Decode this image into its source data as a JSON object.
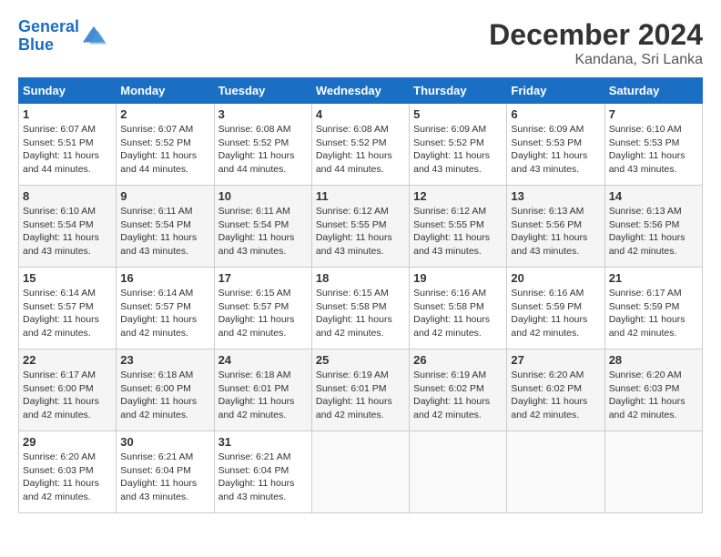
{
  "header": {
    "logo_line1": "General",
    "logo_line2": "Blue",
    "month_title": "December 2024",
    "location": "Kandana, Sri Lanka"
  },
  "weekdays": [
    "Sunday",
    "Monday",
    "Tuesday",
    "Wednesday",
    "Thursday",
    "Friday",
    "Saturday"
  ],
  "weeks": [
    [
      {
        "day": "1",
        "sunrise": "6:07 AM",
        "sunset": "5:51 PM",
        "daylight": "11 hours and 44 minutes."
      },
      {
        "day": "2",
        "sunrise": "6:07 AM",
        "sunset": "5:52 PM",
        "daylight": "11 hours and 44 minutes."
      },
      {
        "day": "3",
        "sunrise": "6:08 AM",
        "sunset": "5:52 PM",
        "daylight": "11 hours and 44 minutes."
      },
      {
        "day": "4",
        "sunrise": "6:08 AM",
        "sunset": "5:52 PM",
        "daylight": "11 hours and 44 minutes."
      },
      {
        "day": "5",
        "sunrise": "6:09 AM",
        "sunset": "5:52 PM",
        "daylight": "11 hours and 43 minutes."
      },
      {
        "day": "6",
        "sunrise": "6:09 AM",
        "sunset": "5:53 PM",
        "daylight": "11 hours and 43 minutes."
      },
      {
        "day": "7",
        "sunrise": "6:10 AM",
        "sunset": "5:53 PM",
        "daylight": "11 hours and 43 minutes."
      }
    ],
    [
      {
        "day": "8",
        "sunrise": "6:10 AM",
        "sunset": "5:54 PM",
        "daylight": "11 hours and 43 minutes."
      },
      {
        "day": "9",
        "sunrise": "6:11 AM",
        "sunset": "5:54 PM",
        "daylight": "11 hours and 43 minutes."
      },
      {
        "day": "10",
        "sunrise": "6:11 AM",
        "sunset": "5:54 PM",
        "daylight": "11 hours and 43 minutes."
      },
      {
        "day": "11",
        "sunrise": "6:12 AM",
        "sunset": "5:55 PM",
        "daylight": "11 hours and 43 minutes."
      },
      {
        "day": "12",
        "sunrise": "6:12 AM",
        "sunset": "5:55 PM",
        "daylight": "11 hours and 43 minutes."
      },
      {
        "day": "13",
        "sunrise": "6:13 AM",
        "sunset": "5:56 PM",
        "daylight": "11 hours and 43 minutes."
      },
      {
        "day": "14",
        "sunrise": "6:13 AM",
        "sunset": "5:56 PM",
        "daylight": "11 hours and 42 minutes."
      }
    ],
    [
      {
        "day": "15",
        "sunrise": "6:14 AM",
        "sunset": "5:57 PM",
        "daylight": "11 hours and 42 minutes."
      },
      {
        "day": "16",
        "sunrise": "6:14 AM",
        "sunset": "5:57 PM",
        "daylight": "11 hours and 42 minutes."
      },
      {
        "day": "17",
        "sunrise": "6:15 AM",
        "sunset": "5:57 PM",
        "daylight": "11 hours and 42 minutes."
      },
      {
        "day": "18",
        "sunrise": "6:15 AM",
        "sunset": "5:58 PM",
        "daylight": "11 hours and 42 minutes."
      },
      {
        "day": "19",
        "sunrise": "6:16 AM",
        "sunset": "5:58 PM",
        "daylight": "11 hours and 42 minutes."
      },
      {
        "day": "20",
        "sunrise": "6:16 AM",
        "sunset": "5:59 PM",
        "daylight": "11 hours and 42 minutes."
      },
      {
        "day": "21",
        "sunrise": "6:17 AM",
        "sunset": "5:59 PM",
        "daylight": "11 hours and 42 minutes."
      }
    ],
    [
      {
        "day": "22",
        "sunrise": "6:17 AM",
        "sunset": "6:00 PM",
        "daylight": "11 hours and 42 minutes."
      },
      {
        "day": "23",
        "sunrise": "6:18 AM",
        "sunset": "6:00 PM",
        "daylight": "11 hours and 42 minutes."
      },
      {
        "day": "24",
        "sunrise": "6:18 AM",
        "sunset": "6:01 PM",
        "daylight": "11 hours and 42 minutes."
      },
      {
        "day": "25",
        "sunrise": "6:19 AM",
        "sunset": "6:01 PM",
        "daylight": "11 hours and 42 minutes."
      },
      {
        "day": "26",
        "sunrise": "6:19 AM",
        "sunset": "6:02 PM",
        "daylight": "11 hours and 42 minutes."
      },
      {
        "day": "27",
        "sunrise": "6:20 AM",
        "sunset": "6:02 PM",
        "daylight": "11 hours and 42 minutes."
      },
      {
        "day": "28",
        "sunrise": "6:20 AM",
        "sunset": "6:03 PM",
        "daylight": "11 hours and 42 minutes."
      }
    ],
    [
      {
        "day": "29",
        "sunrise": "6:20 AM",
        "sunset": "6:03 PM",
        "daylight": "11 hours and 42 minutes."
      },
      {
        "day": "30",
        "sunrise": "6:21 AM",
        "sunset": "6:04 PM",
        "daylight": "11 hours and 43 minutes."
      },
      {
        "day": "31",
        "sunrise": "6:21 AM",
        "sunset": "6:04 PM",
        "daylight": "11 hours and 43 minutes."
      },
      null,
      null,
      null,
      null
    ]
  ],
  "labels": {
    "sunrise": "Sunrise: ",
    "sunset": "Sunset: ",
    "daylight": "Daylight: "
  }
}
